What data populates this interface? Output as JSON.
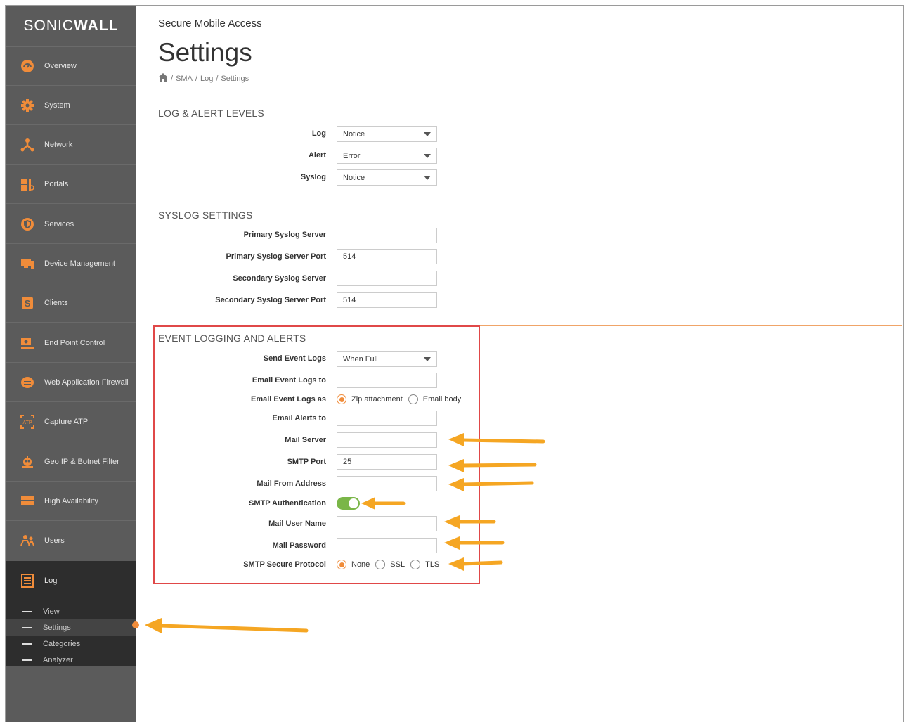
{
  "brand": {
    "name_light": "SONIC",
    "name_bold": "WALL"
  },
  "colors": {
    "accent": "#f08c3a",
    "toggle_on": "#7ab648",
    "sidebar_bg": "#5b5b5b",
    "sidebar_active_bg": "#2d2d2d",
    "highlight": "#e04848",
    "annotation_arrow": "#f5a623"
  },
  "sidebar": {
    "items": [
      {
        "label": "Overview",
        "icon": "gauge-icon"
      },
      {
        "label": "System",
        "icon": "gear-icon"
      },
      {
        "label": "Network",
        "icon": "network-icon"
      },
      {
        "label": "Portals",
        "icon": "portals-icon"
      },
      {
        "label": "Services",
        "icon": "shield-icon"
      },
      {
        "label": "Device Management",
        "icon": "monitor-icon"
      },
      {
        "label": "Clients",
        "icon": "clients-icon"
      },
      {
        "label": "End Point Control",
        "icon": "endpoint-icon"
      },
      {
        "label": "Web Application Firewall",
        "icon": "firewall-icon"
      },
      {
        "label": "Capture ATP",
        "icon": "atp-icon"
      },
      {
        "label": "Geo IP & Botnet Filter",
        "icon": "geoip-icon"
      },
      {
        "label": "High Availability",
        "icon": "server-icon"
      },
      {
        "label": "Users",
        "icon": "users-icon"
      },
      {
        "label": "Log",
        "icon": "log-icon"
      }
    ],
    "subitems": [
      {
        "label": "View"
      },
      {
        "label": "Settings"
      },
      {
        "label": "Categories"
      },
      {
        "label": "Analyzer"
      }
    ]
  },
  "header": {
    "subtitle": "Secure Mobile Access",
    "title": "Settings"
  },
  "breadcrumb": {
    "sep": "/",
    "items": [
      "SMA",
      "Log",
      "Settings"
    ]
  },
  "log_alert_levels": {
    "title": "LOG & ALERT LEVELS",
    "log": {
      "label": "Log",
      "value": "Notice"
    },
    "alert": {
      "label": "Alert",
      "value": "Error"
    },
    "syslog": {
      "label": "Syslog",
      "value": "Notice"
    }
  },
  "syslog_settings": {
    "title": "SYSLOG SETTINGS",
    "primary_server": {
      "label": "Primary Syslog Server",
      "value": ""
    },
    "primary_port": {
      "label": "Primary Syslog Server Port",
      "value": "514"
    },
    "secondary_server": {
      "label": "Secondary Syslog Server",
      "value": ""
    },
    "secondary_port": {
      "label": "Secondary Syslog Server Port",
      "value": "514"
    }
  },
  "event_logging": {
    "title": "EVENT LOGGING AND ALERTS",
    "send_event_logs": {
      "label": "Send Event Logs",
      "value": "When Full"
    },
    "email_event_logs_to": {
      "label": "Email Event Logs to",
      "value": ""
    },
    "email_event_logs_as": {
      "label": "Email Event Logs as",
      "options": [
        "Zip attachment",
        "Email body"
      ],
      "selected": "Zip attachment"
    },
    "email_alerts_to": {
      "label": "Email Alerts to",
      "value": ""
    },
    "mail_server": {
      "label": "Mail Server",
      "value": ""
    },
    "smtp_port": {
      "label": "SMTP Port",
      "value": "25"
    },
    "mail_from": {
      "label": "Mail From Address",
      "value": ""
    },
    "smtp_auth": {
      "label": "SMTP Authentication",
      "enabled": true
    },
    "mail_user": {
      "label": "Mail User Name",
      "value": ""
    },
    "mail_password": {
      "label": "Mail Password",
      "value": ""
    },
    "smtp_secure": {
      "label": "SMTP Secure Protocol",
      "options": [
        "None",
        "SSL",
        "TLS"
      ],
      "selected": "None"
    }
  }
}
